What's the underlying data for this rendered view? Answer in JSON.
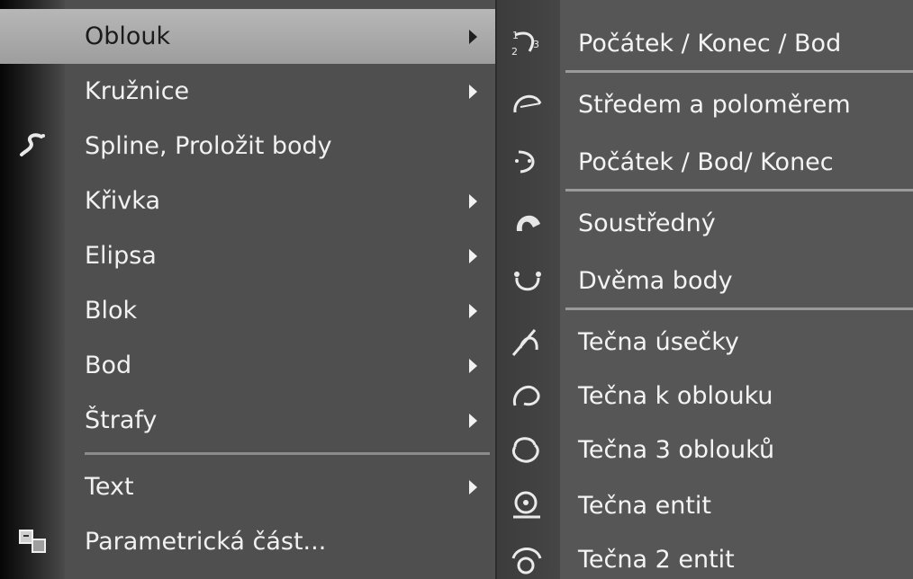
{
  "menu": {
    "items": [
      {
        "label": "Oblouk",
        "submenu": true,
        "highlighted": true
      },
      {
        "label": "Kružnice",
        "submenu": true
      },
      {
        "label": "Spline, Proložit body",
        "submenu": false,
        "icon": "spline-icon"
      },
      {
        "label": "Křivka",
        "submenu": true
      },
      {
        "label": "Elipsa",
        "submenu": true
      },
      {
        "label": "Blok",
        "submenu": true
      },
      {
        "label": "Bod",
        "submenu": true
      },
      {
        "label": "Štrafy",
        "submenu": true
      },
      {
        "label": "Text",
        "submenu": true
      },
      {
        "label": "Parametrická část...",
        "submenu": false,
        "icon": "parametric-part-icon"
      }
    ]
  },
  "submenu": {
    "items": [
      {
        "label": "Počátek / Konec / Bod",
        "icon": "arc-start-end-point-icon"
      },
      {
        "label": "Středem a poloměrem",
        "icon": "arc-center-radius-icon"
      },
      {
        "label": "Počátek / Bod/ Konec",
        "icon": "arc-start-point-end-icon"
      },
      {
        "label": "Soustředný",
        "icon": "arc-concentric-icon"
      },
      {
        "label": "Dvěma body",
        "icon": "arc-two-points-icon"
      },
      {
        "label": "Tečna úsečky",
        "icon": "arc-tangent-line-icon"
      },
      {
        "label": "Tečna k oblouku",
        "icon": "arc-tangent-arc-icon"
      },
      {
        "label": "Tečna 3 oblouků",
        "icon": "arc-tangent-three-arcs-icon"
      },
      {
        "label": "Tečna entit",
        "icon": "arc-tangent-entities-icon"
      },
      {
        "label": "Tečna 2 entit",
        "icon": "arc-tangent-two-entities-icon"
      }
    ]
  },
  "icon_labels": {
    "arc_start_end": "1 2 3"
  }
}
